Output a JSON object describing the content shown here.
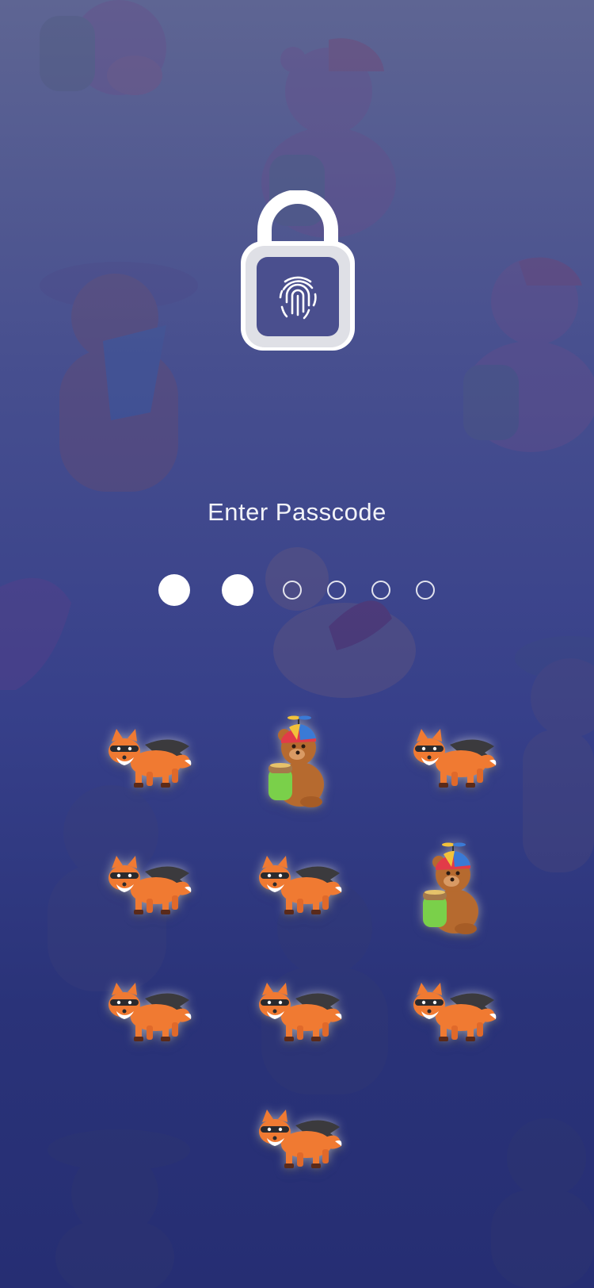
{
  "screen": {
    "title": "Enter Passcode"
  },
  "lock": {
    "icon": "fingerprint-lock-icon"
  },
  "passcode": {
    "length": 6,
    "entered": 2
  },
  "keypad": {
    "keys": [
      {
        "character": "fox"
      },
      {
        "character": "bear"
      },
      {
        "character": "fox"
      },
      {
        "character": "fox"
      },
      {
        "character": "fox"
      },
      {
        "character": "bear"
      },
      {
        "character": "fox"
      },
      {
        "character": "fox"
      },
      {
        "character": "fox"
      },
      {
        "character": "fox"
      }
    ]
  },
  "colors": {
    "background_top": "#5e6593",
    "background_bottom": "#262e73",
    "fox": "#f07a32",
    "bear": "#b66a2f",
    "dot": "#ffffff"
  }
}
